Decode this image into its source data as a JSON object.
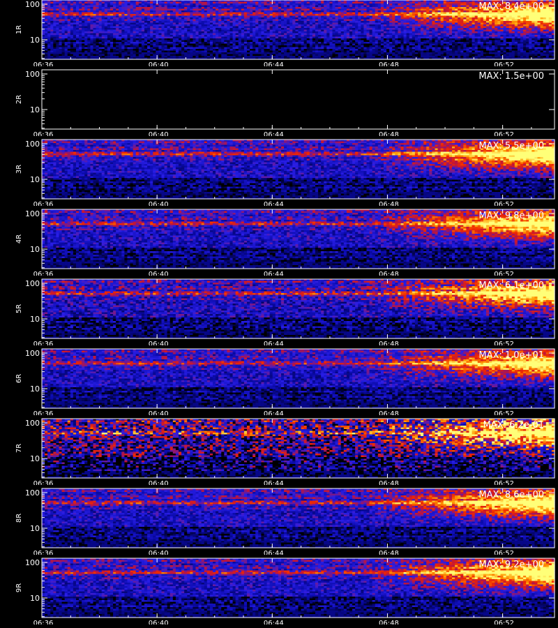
{
  "chart_data": [
    {
      "type": "heatmap",
      "ylabel": "1R",
      "max_label": "MAX: 8.4e+00",
      "yticks": [
        "100",
        "10"
      ],
      "xticks": [
        "06:36",
        "06:40",
        "06:44",
        "06:48",
        "06:52"
      ],
      "intensity": 1.0,
      "noise": 0.35
    },
    {
      "type": "heatmap",
      "ylabel": "2R",
      "max_label": "MAX: 1.5e+00",
      "yticks": [
        "100",
        "10"
      ],
      "xticks": [
        "06:36",
        "06:40",
        "06:44",
        "06:48",
        "06:52"
      ],
      "intensity": 0.0,
      "noise": 0.0
    },
    {
      "type": "heatmap",
      "ylabel": "3R",
      "max_label": "MAX: 5.5e+00",
      "yticks": [
        "100",
        "10"
      ],
      "xticks": [
        "06:36",
        "06:40",
        "06:44",
        "06:48",
        "06:52"
      ],
      "intensity": 1.05,
      "noise": 0.35
    },
    {
      "type": "heatmap",
      "ylabel": "4R",
      "max_label": "MAX: 9.8e+00",
      "yticks": [
        "100",
        "10"
      ],
      "xticks": [
        "06:36",
        "06:40",
        "06:44",
        "06:48",
        "06:52"
      ],
      "intensity": 0.95,
      "noise": 0.35
    },
    {
      "type": "heatmap",
      "ylabel": "5R",
      "max_label": "MAX: 6.1e+00",
      "yticks": [
        "100",
        "10"
      ],
      "xticks": [
        "06:36",
        "06:40",
        "06:44",
        "06:48",
        "06:52"
      ],
      "intensity": 1.0,
      "noise": 0.4
    },
    {
      "type": "heatmap",
      "ylabel": "6R",
      "max_label": "MAX: 1.0e+01",
      "yticks": [
        "100",
        "10"
      ],
      "xticks": [
        "06:36",
        "06:40",
        "06:44",
        "06:48",
        "06:52"
      ],
      "intensity": 0.9,
      "noise": 0.35
    },
    {
      "type": "heatmap",
      "ylabel": "7R",
      "max_label": "MAX: 6.2e-01",
      "yticks": [
        "100",
        "10"
      ],
      "xticks": [
        "06:36",
        "06:40",
        "06:44",
        "06:48",
        "06:52"
      ],
      "intensity": 1.1,
      "noise": 0.75
    },
    {
      "type": "heatmap",
      "ylabel": "8R",
      "max_label": "MAX: 8.6e+00",
      "yticks": [
        "100",
        "10"
      ],
      "xticks": [
        "06:36",
        "06:40",
        "06:44",
        "06:48",
        "06:52"
      ],
      "intensity": 1.0,
      "noise": 0.35
    },
    {
      "type": "heatmap",
      "ylabel": "9R",
      "max_label": "MAX: 9.2e+00",
      "yticks": [
        "100",
        "10"
      ],
      "xticks": [
        "06:36",
        "06:40",
        "06:44",
        "06:48",
        "06:52"
      ],
      "intensity": 1.05,
      "noise": 0.35
    }
  ],
  "colors": {
    "background": "#000000",
    "axis": "#ffffff",
    "low": "#0000cc",
    "mid": "#ff2000",
    "high": "#ffff60"
  }
}
